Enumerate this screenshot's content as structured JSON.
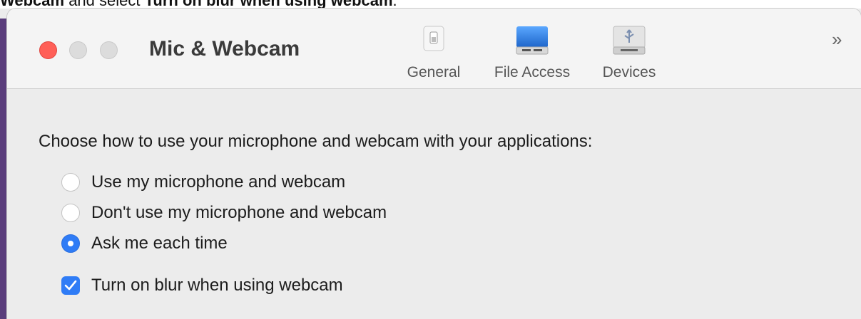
{
  "caption": {
    "prefix_bold": "Webcam",
    "middle": " and select ",
    "suffix_bold": "Turn on blur when using webcam",
    "end": "."
  },
  "window": {
    "title": "Mic & Webcam",
    "tabs": [
      {
        "label": "General",
        "icon": "switch-icon"
      },
      {
        "label": "File Access",
        "icon": "hard-drive-icon"
      },
      {
        "label": "Devices",
        "icon": "usb-drive-icon"
      }
    ],
    "overflow_glyph": "»"
  },
  "content": {
    "prompt": "Choose how to use your microphone and webcam with your applications:",
    "options": [
      {
        "label": "Use my microphone and webcam",
        "selected": false
      },
      {
        "label": "Don't use my microphone and webcam",
        "selected": false
      },
      {
        "label": "Ask me each time",
        "selected": true
      }
    ],
    "blur_checkbox": {
      "label": "Turn on blur when using webcam",
      "checked": true
    }
  },
  "colors": {
    "accent": "#2f7cf6",
    "close": "#ff5f57",
    "backdrop": "#5a3d7c"
  }
}
